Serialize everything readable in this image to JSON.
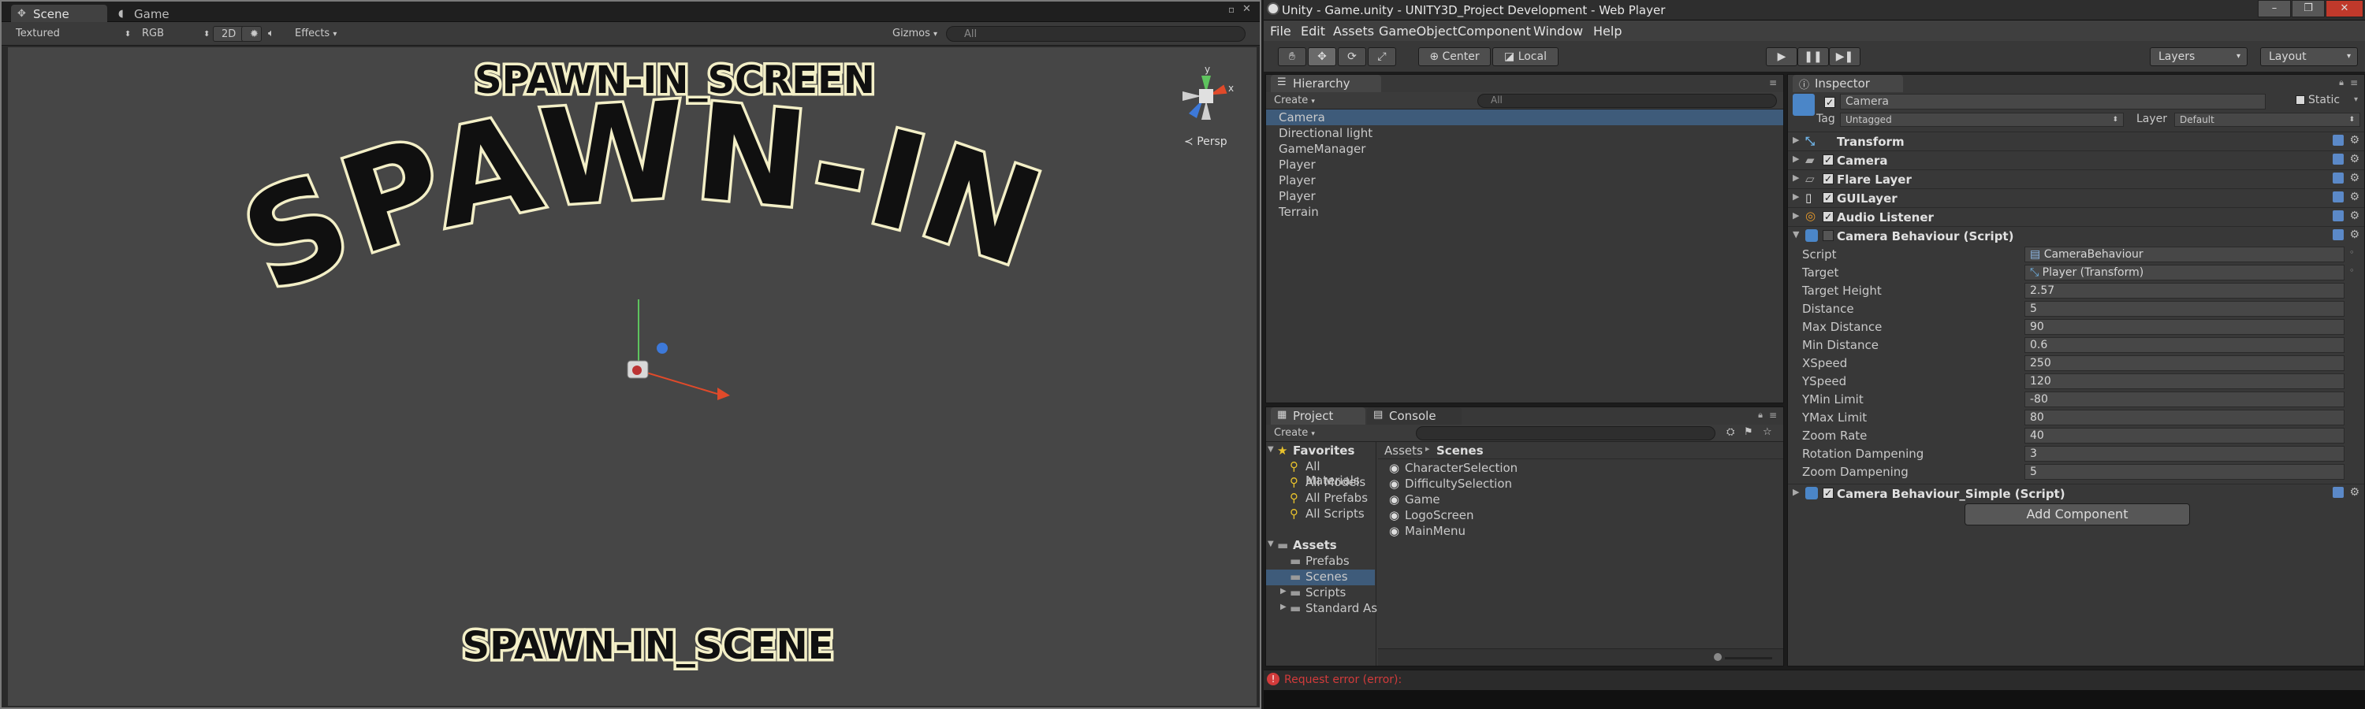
{
  "scene_window": {
    "tabs": [
      {
        "label": "Scene",
        "icon": "scene-icon"
      },
      {
        "label": "Game",
        "icon": "pacman-icon"
      }
    ],
    "toolbar": {
      "shading": "Textured",
      "render_mode": "RGB",
      "mode_2d": "2D",
      "effects": "Effects",
      "gizmos": "Gizmos",
      "search_placeholder": "All"
    },
    "persp_label": "Persp",
    "scene_texts": {
      "top": "SPAWN-IN_SCREEN",
      "arc": "SPAWN-IN",
      "bottom": "SPAWN-IN_SCENE"
    }
  },
  "editor": {
    "title": "Unity - Game.unity - UNITY3D_Project Development - Web Player",
    "window_buttons": [
      "–",
      "❐",
      "✕"
    ],
    "menu": [
      "File",
      "Edit",
      "Assets",
      "GameObject",
      "Component",
      "Window",
      "Help"
    ],
    "toolbar": {
      "pivot": "Center",
      "space": "Local",
      "layers": "Layers",
      "layout": "Layout"
    },
    "hierarchy": {
      "tab": "Hierarchy",
      "create": "Create",
      "search_placeholder": "All",
      "items": [
        "Camera",
        "Directional light",
        "GameManager",
        "Player",
        "Player",
        "Player",
        "Terrain"
      ]
    },
    "project": {
      "tabs": [
        "Project",
        "Console"
      ],
      "create": "Create",
      "favorites_label": "Favorites",
      "favorites": [
        "All Materials",
        "All Models",
        "All Prefabs",
        "All Scripts"
      ],
      "assets_label": "Assets",
      "folders": [
        "Prefabs",
        "Scenes",
        "Scripts",
        "Standard As"
      ],
      "breadcrumb": [
        "Assets",
        "Scenes"
      ],
      "files": [
        "CharacterSelection",
        "DifficultySelection",
        "Game",
        "LogoScreen",
        "MainMenu"
      ]
    },
    "inspector": {
      "tab": "Inspector",
      "object_name": "Camera",
      "static_label": "Static",
      "tag_label": "Tag",
      "tag_value": "Untagged",
      "layer_label": "Layer",
      "layer_value": "Default",
      "components": [
        "Transform",
        "Camera",
        "Flare Layer",
        "GUILayer",
        "Audio Listener",
        "Camera Behaviour (Script)"
      ],
      "properties": [
        {
          "label": "Script",
          "value": "CameraBehaviour"
        },
        {
          "label": "Target",
          "value": "Player (Transform)"
        },
        {
          "label": "Target Height",
          "value": "2.57"
        },
        {
          "label": "Distance",
          "value": "5"
        },
        {
          "label": "Max Distance",
          "value": "90"
        },
        {
          "label": "Min Distance",
          "value": "0.6"
        },
        {
          "label": "XSpeed",
          "value": "250"
        },
        {
          "label": "YSpeed",
          "value": "120"
        },
        {
          "label": "YMin Limit",
          "value": "-80"
        },
        {
          "label": "YMax Limit",
          "value": "80"
        },
        {
          "label": "Zoom Rate",
          "value": "40"
        },
        {
          "label": "Rotation Dampening",
          "value": "3"
        },
        {
          "label": "Zoom Dampening",
          "value": "5"
        }
      ],
      "extra_component": "Camera Behaviour_Simple (Script)",
      "add_component": "Add Component"
    },
    "status": {
      "text": "Request error (error):",
      "color": "#d23b3b"
    }
  }
}
